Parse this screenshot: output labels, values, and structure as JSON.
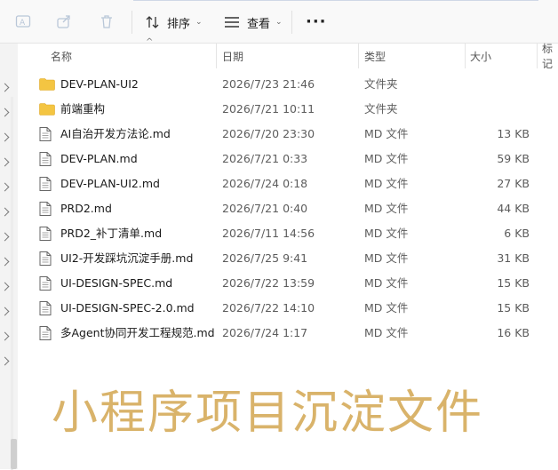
{
  "toolbar": {
    "rename_icon": "rename-icon",
    "share_icon": "share-icon",
    "delete_icon": "delete-icon",
    "sort_label": "排序",
    "view_label": "查看",
    "more_label": "···"
  },
  "columns": {
    "name": "名称",
    "date": "日期",
    "type": "类型",
    "size": "大小",
    "tag": "标记"
  },
  "files": [
    {
      "name": "DEV-PLAN-UI2",
      "date": "2026/7/23 21:46",
      "type": "文件夹",
      "size": "",
      "icon": "folder-icon"
    },
    {
      "name": "前端重构",
      "date": "2026/7/21 10:11",
      "type": "文件夹",
      "size": "",
      "icon": "folder-icon"
    },
    {
      "name": "AI自治开发方法论.md",
      "date": "2026/7/20 23:30",
      "type": "MD 文件",
      "size": "13 KB",
      "icon": "document-icon"
    },
    {
      "name": "DEV-PLAN.md",
      "date": "2026/7/21 0:33",
      "type": "MD 文件",
      "size": "59 KB",
      "icon": "document-icon"
    },
    {
      "name": "DEV-PLAN-UI2.md",
      "date": "2026/7/24 0:18",
      "type": "MD 文件",
      "size": "27 KB",
      "icon": "document-icon"
    },
    {
      "name": "PRD2.md",
      "date": "2026/7/21 0:40",
      "type": "MD 文件",
      "size": "44 KB",
      "icon": "document-icon"
    },
    {
      "name": "PRD2_补丁清单.md",
      "date": "2026/7/11 14:56",
      "type": "MD 文件",
      "size": "6 KB",
      "icon": "document-icon"
    },
    {
      "name": "UI2-开发踩坑沉淀手册.md",
      "date": "2026/7/25 9:41",
      "type": "MD 文件",
      "size": "31 KB",
      "icon": "document-icon"
    },
    {
      "name": "UI-DESIGN-SPEC.md",
      "date": "2026/7/22 13:59",
      "type": "MD 文件",
      "size": "15 KB",
      "icon": "document-icon"
    },
    {
      "name": "UI-DESIGN-SPEC-2.0.md",
      "date": "2026/7/22 14:10",
      "type": "MD 文件",
      "size": "15 KB",
      "icon": "document-icon"
    },
    {
      "name": "多Agent协同开发工程规范.md",
      "date": "2026/7/24 1:17",
      "type": "MD 文件",
      "size": "16 KB",
      "icon": "document-icon"
    }
  ],
  "watermark": "小程序项目沉淀文件",
  "colors": {
    "folder": "#f4c542",
    "watermark": "#d9b36a",
    "toolbar_bg": "#f9f9f9"
  }
}
